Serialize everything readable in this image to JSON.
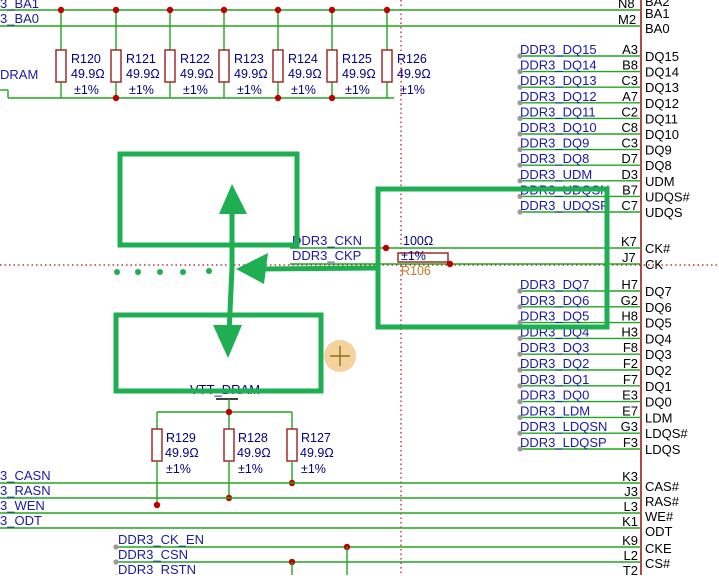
{
  "colors": {
    "wire": "#22a522",
    "net_label": "#1a1aa6",
    "resistor": "#9b1c1c",
    "junction": "#c00000",
    "sheet_border": "#b01010",
    "annotation": "#1fae52",
    "cursor": "#f4c27a"
  },
  "top_nets": [
    "3_BA1",
    "3_BA0",
    "DRAM"
  ],
  "resistor_row_top": [
    {
      "des": "R120",
      "val": "49.9Ω",
      "tol": "±1%"
    },
    {
      "des": "R121",
      "val": "49.9Ω",
      "tol": "±1%"
    },
    {
      "des": "R122",
      "val": "49.9Ω",
      "tol": "±1%"
    },
    {
      "des": "R123",
      "val": "49.9Ω",
      "tol": "±1%"
    },
    {
      "des": "R124",
      "val": "49.9Ω",
      "tol": "±1%"
    },
    {
      "des": "R125",
      "val": "49.9Ω",
      "tol": "±1%"
    },
    {
      "des": "R126",
      "val": "49.9Ω",
      "tol": "±1%"
    }
  ],
  "upper_dq_nets": [
    {
      "net": "DDR3_DQ15",
      "pin": "A3",
      "name": "DQ15"
    },
    {
      "net": "DDR3_DQ14",
      "pin": "B8",
      "name": "DQ14"
    },
    {
      "net": "DDR3_DQ13",
      "pin": "C3",
      "name": "DQ13"
    },
    {
      "net": "DDR3_DQ12",
      "pin": "A7",
      "name": "DQ12"
    },
    {
      "net": "DDR3_DQ11",
      "pin": "C2",
      "name": "DQ11"
    },
    {
      "net": "DDR3_DQ10",
      "pin": "C8",
      "name": "DQ10"
    },
    {
      "net": "DDR3_DQ9",
      "pin": "C3",
      "name": "DQ9"
    },
    {
      "net": "DDR3_DQ8",
      "pin": "D7",
      "name": "DQ8"
    },
    {
      "net": "DDR3_UDM",
      "pin": "D3",
      "name": "UDM"
    },
    {
      "net": "DDR3_UDQSN",
      "pin": "B7",
      "name": "UDQS#"
    },
    {
      "net": "DDR3_UDQSP",
      "pin": "C7",
      "name": "UDQS"
    }
  ],
  "top_pins": [
    {
      "pin": "N8",
      "name": "BA2"
    },
    {
      "pin": "M2",
      "name": "BA1"
    },
    {
      "pin": "",
      "name": "BA0"
    }
  ],
  "clock": {
    "net_n": "DDR3_CKN",
    "net_p": "DDR3_CKP",
    "res_value": "100Ω",
    "res_tol": "±1%",
    "res_des": "R106",
    "pin_n": "K7",
    "name_n": "CK#",
    "pin_p": "J7",
    "name_p": "CK"
  },
  "lower_dq_nets": [
    {
      "net": "DDR3_DQ7",
      "pin": "H7",
      "name": "DQ7"
    },
    {
      "net": "DDR3_DQ6",
      "pin": "G2",
      "name": "DQ6"
    },
    {
      "net": "DDR3_DQ5",
      "pin": "H8",
      "name": "DQ5"
    },
    {
      "net": "DDR3_DQ4",
      "pin": "H3",
      "name": "DQ4"
    },
    {
      "net": "DDR3_DQ3",
      "pin": "F8",
      "name": "DQ3"
    },
    {
      "net": "DDR3_DQ2",
      "pin": "F2",
      "name": "DQ2"
    },
    {
      "net": "DDR3_DQ1",
      "pin": "F7",
      "name": "DQ1"
    },
    {
      "net": "DDR3_DQ0",
      "pin": "E3",
      "name": "DQ0"
    },
    {
      "net": "DDR3_LDM",
      "pin": "E7",
      "name": "LDM"
    },
    {
      "net": "DDR3_LDQSN",
      "pin": "G3",
      "name": "LDQS#"
    },
    {
      "net": "DDR3_LDQSP",
      "pin": "F3",
      "name": "LDQS"
    }
  ],
  "vtt_label": "VTT_DRAM",
  "resistor_row_bottom": [
    {
      "des": "R129",
      "val": "49.9Ω",
      "tol": "±1%"
    },
    {
      "des": "R128",
      "val": "49.9Ω",
      "tol": "±1%"
    },
    {
      "des": "R127",
      "val": "49.9Ω",
      "tol": "±1%"
    }
  ],
  "control_nets": [
    {
      "net": "3_CASN",
      "pin": "K3",
      "name": "CAS#"
    },
    {
      "net": "3_RASN",
      "pin": "J3",
      "name": "RAS#"
    },
    {
      "net": "3_WEN",
      "pin": "L3",
      "name": "WE#"
    },
    {
      "net": "3_ODT",
      "pin": "K1",
      "name": "ODT"
    }
  ],
  "bottom_nets": [
    {
      "net": "DDR3_CK_EN",
      "pin": "K9",
      "name": "CKE"
    },
    {
      "net": "DDR3_CSN",
      "pin": "L2",
      "name": "CS#"
    },
    {
      "net": "DDR3_RSTN",
      "pin": "T2",
      "name": ""
    }
  ]
}
